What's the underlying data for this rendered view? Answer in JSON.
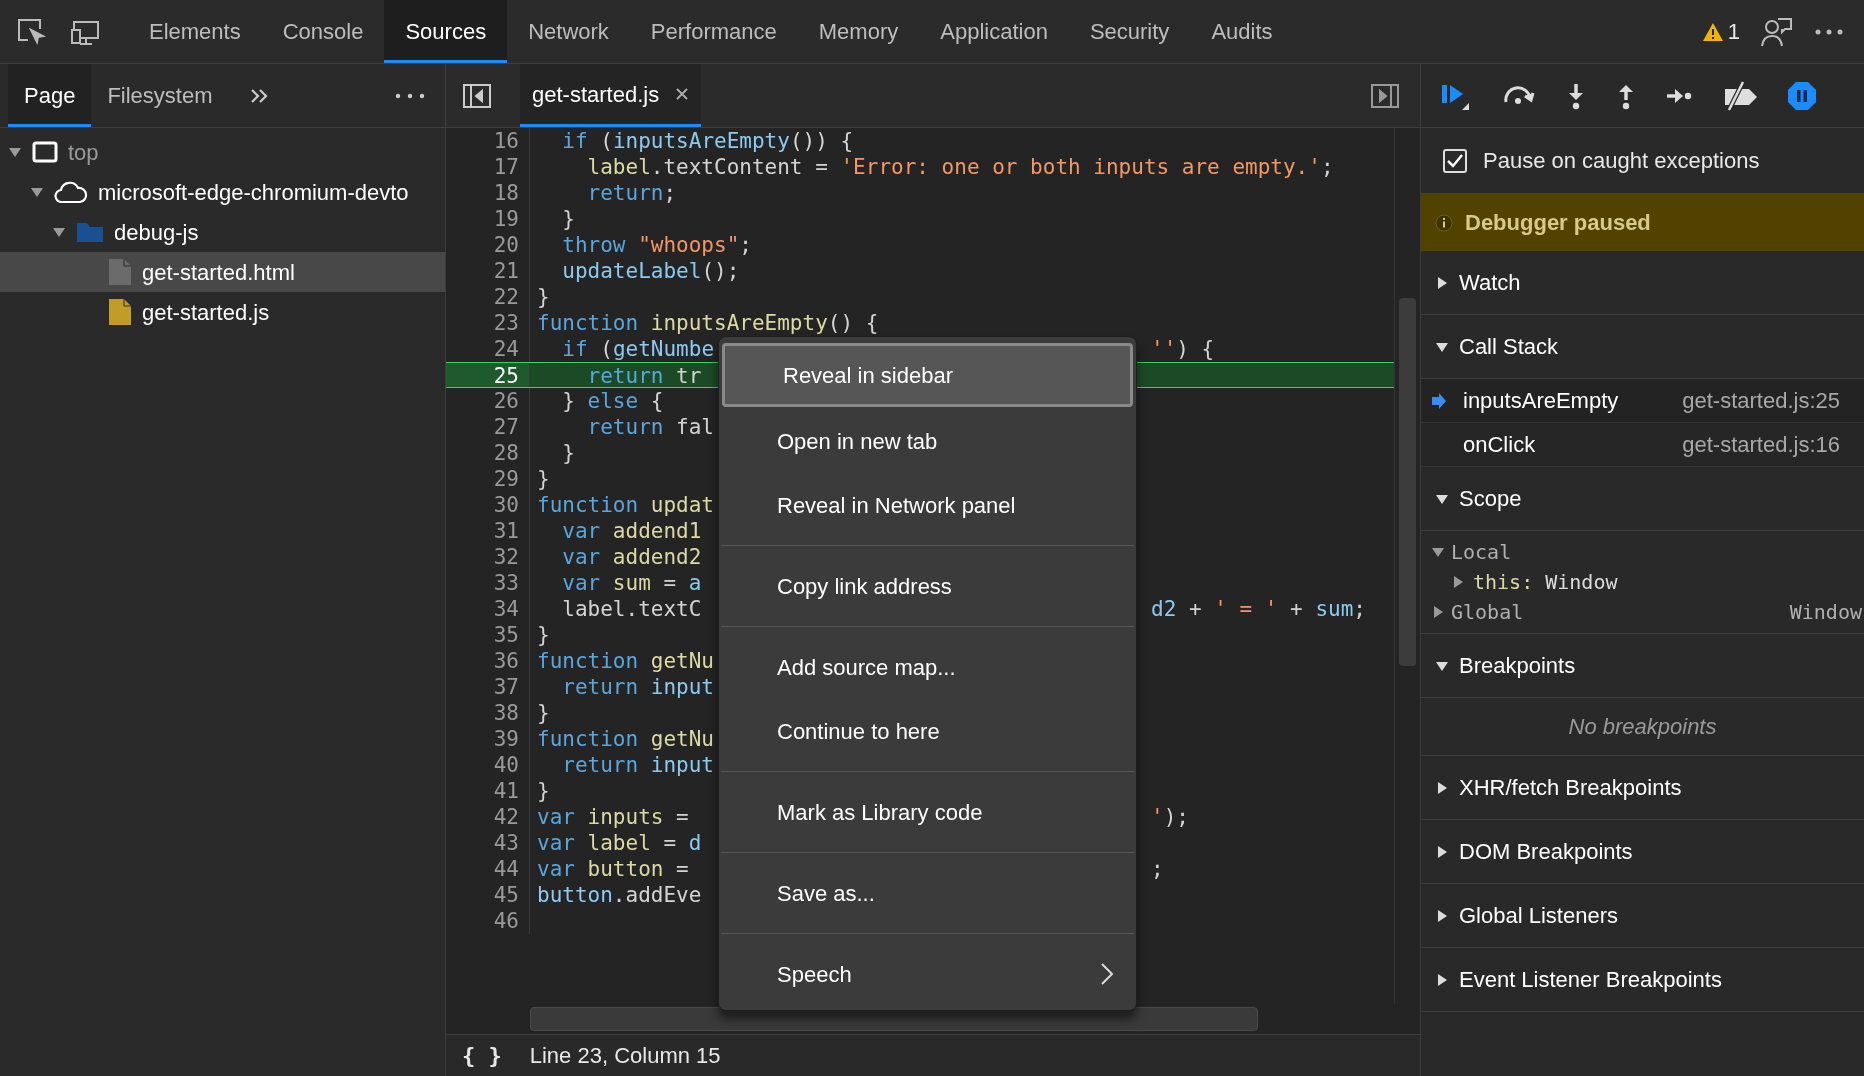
{
  "toolbar": {
    "tabs": [
      {
        "label": "Elements",
        "selected": false
      },
      {
        "label": "Console",
        "selected": false
      },
      {
        "label": "Sources",
        "selected": true
      },
      {
        "label": "Network",
        "selected": false
      },
      {
        "label": "Performance",
        "selected": false
      },
      {
        "label": "Memory",
        "selected": false
      },
      {
        "label": "Application",
        "selected": false
      },
      {
        "label": "Security",
        "selected": false
      },
      {
        "label": "Audits",
        "selected": false
      }
    ],
    "warnings": "1"
  },
  "navigator": {
    "tabs": [
      {
        "label": "Page",
        "selected": true
      },
      {
        "label": "Filesystem",
        "selected": false
      }
    ],
    "tree": [
      {
        "label": "top",
        "kind": "frame",
        "expanded": true,
        "selected": false,
        "children": [
          {
            "label": "microsoft-edge-chromium-devto",
            "kind": "domain",
            "expanded": true,
            "selected": false,
            "children": [
              {
                "label": "debug-js",
                "kind": "folder",
                "expanded": true,
                "selected": false,
                "children": [
                  {
                    "label": "get-started.html",
                    "kind": "file",
                    "color": "#6b6b6b",
                    "selected": true
                  },
                  {
                    "label": "get-started.js",
                    "kind": "file",
                    "color": "#c29d26",
                    "selected": false
                  }
                ]
              }
            ]
          }
        ]
      }
    ]
  },
  "editor": {
    "tabs": [
      {
        "label": "get-started.js",
        "selected": true
      }
    ],
    "lines": [
      {
        "number": "16",
        "paused": false,
        "left": [
          {
            "text": "  if",
            "color": "#5aa6dc"
          },
          {
            "text": " (",
            "color": "#d4d4d4"
          },
          {
            "text": "inputsAreEmpty",
            "color": "#8ccaf0"
          },
          {
            "text": "()) {",
            "color": "#d4d4d4"
          }
        ]
      },
      {
        "number": "17",
        "paused": false,
        "left": [
          {
            "text": "    label",
            "color": "#dcd9a4"
          },
          {
            "text": ".textContent =",
            "color": "#d4d4d4"
          },
          {
            "text": " 'Error: one or both inputs are empty.'",
            "color": "#f29766"
          },
          {
            "text": ";",
            "color": "#d4d4d4"
          }
        ]
      },
      {
        "number": "18",
        "paused": false,
        "left": [
          {
            "text": "    return",
            "color": "#5aa6dc"
          },
          {
            "text": ";",
            "color": "#d4d4d4"
          }
        ]
      },
      {
        "number": "19",
        "paused": false,
        "left": [
          {
            "text": "  }",
            "color": "#d4d4d4"
          }
        ]
      },
      {
        "number": "20",
        "paused": false,
        "left": [
          {
            "text": "  throw",
            "color": "#5aa6dc"
          },
          {
            "text": " \"whoops\"",
            "color": "#f29766"
          },
          {
            "text": ";",
            "color": "#d4d4d4"
          }
        ]
      },
      {
        "number": "21",
        "paused": false,
        "left": [
          {
            "text": "  updateLabel",
            "color": "#8ccaf0"
          },
          {
            "text": "();",
            "color": "#d4d4d4"
          }
        ]
      },
      {
        "number": "22",
        "paused": false,
        "left": [
          {
            "text": "}",
            "color": "#d4d4d4"
          }
        ]
      },
      {
        "number": "23",
        "paused": false,
        "left": [
          {
            "text": "function",
            "color": "#5aa6dc"
          },
          {
            "text": " inputsAreEmpty",
            "color": "#dcd9a4"
          },
          {
            "text": "() {",
            "color": "#d4d4d4"
          }
        ]
      },
      {
        "number": "24",
        "paused": false,
        "left": [
          {
            "text": "  if",
            "color": "#5aa6dc"
          },
          {
            "text": " (",
            "color": "#d4d4d4"
          },
          {
            "text": "getNumbe",
            "color": "#8ccaf0"
          }
        ],
        "right": [
          {
            "text": "''",
            "color": "#f29766"
          },
          {
            "text": ") {",
            "color": "#d4d4d4"
          }
        ]
      },
      {
        "number": "25",
        "paused": true,
        "left": [
          {
            "text": "    return",
            "color": "#5aa6dc"
          },
          {
            "text": " tr",
            "color": "#d4d4d4"
          }
        ]
      },
      {
        "number": "26",
        "paused": false,
        "left": [
          {
            "text": "  }",
            "color": "#d4d4d4"
          },
          {
            "text": " else",
            "color": "#5aa6dc"
          },
          {
            "text": " {",
            "color": "#d4d4d4"
          }
        ]
      },
      {
        "number": "27",
        "paused": false,
        "left": [
          {
            "text": "    return",
            "color": "#5aa6dc"
          },
          {
            "text": " fal",
            "color": "#d4d4d4"
          }
        ]
      },
      {
        "number": "28",
        "paused": false,
        "left": [
          {
            "text": "  }",
            "color": "#d4d4d4"
          }
        ]
      },
      {
        "number": "29",
        "paused": false,
        "left": [
          {
            "text": "}",
            "color": "#d4d4d4"
          }
        ]
      },
      {
        "number": "30",
        "paused": false,
        "left": [
          {
            "text": "function",
            "color": "#5aa6dc"
          },
          {
            "text": " updat",
            "color": "#dcd9a4"
          }
        ]
      },
      {
        "number": "31",
        "paused": false,
        "left": [
          {
            "text": "  var",
            "color": "#5aa6dc"
          },
          {
            "text": " addend1",
            "color": "#dcd9a4"
          }
        ]
      },
      {
        "number": "32",
        "paused": false,
        "left": [
          {
            "text": "  var",
            "color": "#5aa6dc"
          },
          {
            "text": " addend2",
            "color": "#dcd9a4"
          }
        ]
      },
      {
        "number": "33",
        "paused": false,
        "left": [
          {
            "text": "  var",
            "color": "#5aa6dc"
          },
          {
            "text": " sum",
            "color": "#dcd9a4"
          },
          {
            "text": " =",
            "color": "#d4d4d4"
          },
          {
            "text": " a",
            "color": "#8ccaf0"
          }
        ]
      },
      {
        "number": "34",
        "paused": false,
        "left": [
          {
            "text": "  label.textC",
            "color": "#d4d4d4"
          }
        ],
        "right": [
          {
            "text": "d2",
            "color": "#8ccaf0"
          },
          {
            "text": " +",
            "color": "#d4d4d4"
          },
          {
            "text": " ' = '",
            "color": "#f29766"
          },
          {
            "text": " +",
            "color": "#d4d4d4"
          },
          {
            "text": " sum",
            "color": "#8ccaf0"
          },
          {
            "text": ";",
            "color": "#d4d4d4"
          }
        ]
      },
      {
        "number": "35",
        "paused": false,
        "left": [
          {
            "text": "}",
            "color": "#d4d4d4"
          }
        ]
      },
      {
        "number": "36",
        "paused": false,
        "left": [
          {
            "text": "function",
            "color": "#5aa6dc"
          },
          {
            "text": " getNu",
            "color": "#dcd9a4"
          }
        ]
      },
      {
        "number": "37",
        "paused": false,
        "left": [
          {
            "text": "  return",
            "color": "#5aa6dc"
          },
          {
            "text": " input",
            "color": "#8ccaf0"
          }
        ]
      },
      {
        "number": "38",
        "paused": false,
        "left": [
          {
            "text": "}",
            "color": "#d4d4d4"
          }
        ]
      },
      {
        "number": "39",
        "paused": false,
        "left": [
          {
            "text": "function",
            "color": "#5aa6dc"
          },
          {
            "text": " getNu",
            "color": "#dcd9a4"
          }
        ]
      },
      {
        "number": "40",
        "paused": false,
        "left": [
          {
            "text": "  return",
            "color": "#5aa6dc"
          },
          {
            "text": " input",
            "color": "#8ccaf0"
          }
        ]
      },
      {
        "number": "41",
        "paused": false,
        "left": [
          {
            "text": "}",
            "color": "#d4d4d4"
          }
        ]
      },
      {
        "number": "42",
        "paused": false,
        "left": [
          {
            "text": "var",
            "color": "#5aa6dc"
          },
          {
            "text": " inputs",
            "color": "#dcd9a4"
          },
          {
            "text": " =",
            "color": "#d4d4d4"
          }
        ],
        "right": [
          {
            "text": "'",
            "color": "#f29766"
          },
          {
            "text": ");",
            "color": "#d4d4d4"
          }
        ]
      },
      {
        "number": "43",
        "paused": false,
        "left": [
          {
            "text": "var",
            "color": "#5aa6dc"
          },
          {
            "text": " label",
            "color": "#dcd9a4"
          },
          {
            "text": " =",
            "color": "#d4d4d4"
          },
          {
            "text": " d",
            "color": "#8ccaf0"
          }
        ]
      },
      {
        "number": "44",
        "paused": false,
        "left": [
          {
            "text": "var",
            "color": "#5aa6dc"
          },
          {
            "text": " button",
            "color": "#dcd9a4"
          },
          {
            "text": " =",
            "color": "#d4d4d4"
          }
        ],
        "right": [
          {
            "text": ";",
            "color": "#d4d4d4"
          }
        ]
      },
      {
        "number": "45",
        "paused": false,
        "left": [
          {
            "text": "button",
            "color": "#8ccaf0"
          },
          {
            "text": ".addEve",
            "color": "#d4d4d4"
          }
        ]
      },
      {
        "number": "46",
        "paused": false
      }
    ],
    "menu": {
      "groups": [
        [
          {
            "label": "Reveal in sidebar",
            "selected": true,
            "submenu": false
          },
          {
            "label": "Open in new tab",
            "selected": false,
            "submenu": false
          },
          {
            "label": "Reveal in Network panel",
            "selected": false,
            "submenu": false
          }
        ],
        [
          {
            "label": "Copy link address",
            "selected": false,
            "submenu": false
          }
        ],
        [
          {
            "label": "Add source map...",
            "selected": false,
            "submenu": false
          },
          {
            "label": "Continue to here",
            "selected": false,
            "submenu": false
          }
        ],
        [
          {
            "label": "Mark as Library code",
            "selected": false,
            "submenu": false
          }
        ],
        [
          {
            "label": "Save as...",
            "selected": false,
            "submenu": false
          }
        ],
        [
          {
            "label": "Speech",
            "selected": false,
            "submenu": true
          }
        ]
      ]
    },
    "status": {
      "format": "{ }",
      "position": "Line 23, Column 15"
    }
  },
  "debugger": {
    "pause_on_caught": {
      "label": "Pause on caught exceptions",
      "checked": true
    },
    "banner": "Debugger paused",
    "sections": [
      {
        "title": "Watch",
        "expanded": false
      },
      {
        "title": "Call Stack",
        "expanded": true,
        "frames": [
          {
            "name": "inputsAreEmpty",
            "location": "get-started.js:25",
            "selected": true
          },
          {
            "name": "onClick",
            "location": "get-started.js:16",
            "selected": false
          }
        ]
      },
      {
        "title": "Scope",
        "expanded": true,
        "scopes": [
          {
            "label": "Local",
            "expanded": true,
            "children": [
              {
                "label": "this:",
                "value": "Window",
                "expanded": false
              }
            ]
          },
          {
            "label": "Global",
            "value": "Window",
            "expanded": false
          }
        ]
      },
      {
        "title": "Breakpoints",
        "expanded": true,
        "empty": "No breakpoints"
      },
      {
        "title": "XHR/fetch Breakpoints",
        "expanded": false
      },
      {
        "title": "DOM Breakpoints",
        "expanded": false
      },
      {
        "title": "Global Listeners",
        "expanded": false
      },
      {
        "title": "Event Listener Breakpoints",
        "expanded": false
      }
    ]
  }
}
